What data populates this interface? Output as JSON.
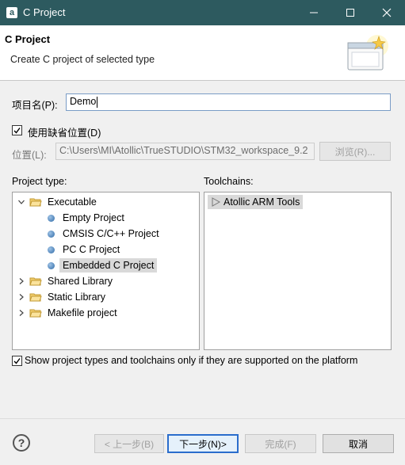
{
  "window": {
    "app_icon": "a",
    "title": "C Project",
    "icons": [
      "minimize-icon",
      "maximize-icon",
      "close-icon"
    ]
  },
  "banner": {
    "title": "C Project",
    "description": "Create C project of selected type"
  },
  "form": {
    "project_name_label": "项目名(P):",
    "project_name_value": "Demo",
    "use_default_location_label": "使用缺省位置(D)",
    "use_default_location_checked": true,
    "location_label": "位置(L):",
    "location_value": "C:\\Users\\MI\\Atollic\\TrueSTUDIO\\STM32_workspace_9.2",
    "browse_label": "浏览(R)..."
  },
  "project_type": {
    "label": "Project type:",
    "items": [
      {
        "label": "Executable",
        "kind": "folder",
        "expanded": true
      },
      {
        "label": "Empty Project",
        "kind": "item"
      },
      {
        "label": "CMSIS C/C++ Project",
        "kind": "item"
      },
      {
        "label": "PC C Project",
        "kind": "item"
      },
      {
        "label": "Embedded C Project",
        "kind": "item",
        "selected": true
      },
      {
        "label": "Shared Library",
        "kind": "folder",
        "expanded": false
      },
      {
        "label": "Static Library",
        "kind": "folder",
        "expanded": false
      },
      {
        "label": "Makefile project",
        "kind": "folder",
        "expanded": false
      }
    ]
  },
  "toolchains": {
    "label": "Toolchains:",
    "items": [
      {
        "label": "Atollic ARM Tools",
        "selected": true
      }
    ]
  },
  "filter": {
    "label": "Show project types and toolchains only if they are supported on the platform",
    "checked": true
  },
  "buttons": {
    "back": "< 上一步(B)",
    "next": "下一步(N)>",
    "finish": "完成(F)",
    "cancel": "取消"
  }
}
